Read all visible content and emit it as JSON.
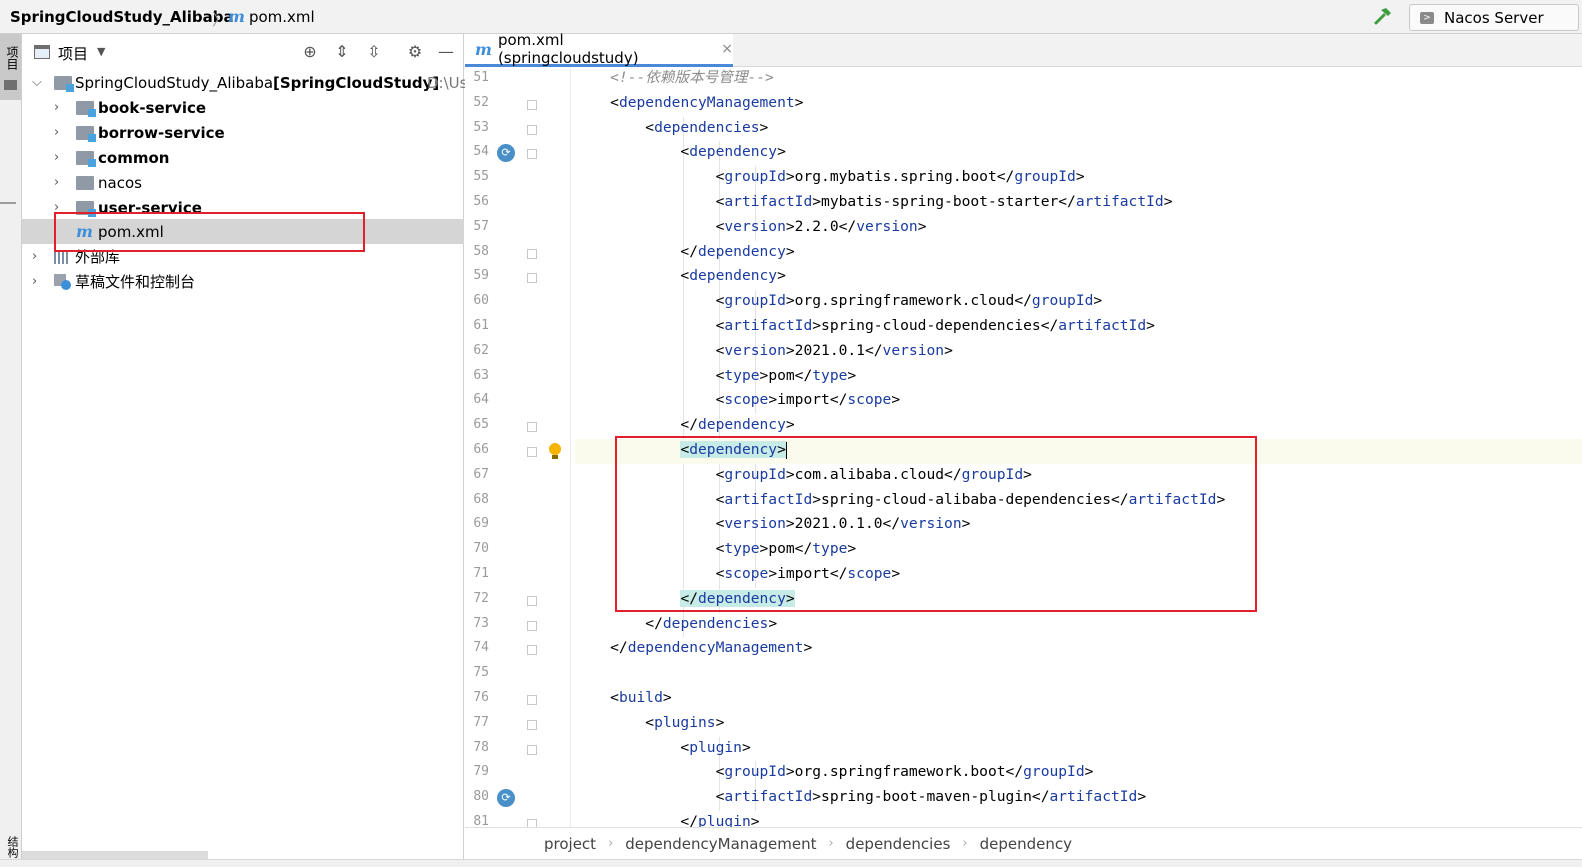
{
  "navbar": {
    "project_name": "SpringCloudStudy_Alibaba",
    "file_name": "pom.xml",
    "file_icon": "m",
    "run_config": "Nacos Server"
  },
  "stripe": {
    "project_tab": "项目",
    "structure_tab": "结构"
  },
  "project_panel": {
    "title": "项目",
    "tree": [
      {
        "label": "SpringCloudStudy_Alibaba",
        "module": "[SpringCloudStudy]",
        "path": "D:\\Us"
      },
      {
        "label": "book-service"
      },
      {
        "label": "borrow-service"
      },
      {
        "label": "common"
      },
      {
        "label": "nacos"
      },
      {
        "label": "user-service"
      },
      {
        "label": "pom.xml",
        "icon": "m"
      },
      {
        "label": "外部库"
      },
      {
        "label": "草稿文件和控制台"
      }
    ]
  },
  "editor": {
    "tab_label": "pom.xml (springcloudstudy)",
    "tab_close": "×",
    "lines": [
      {
        "n": "51",
        "text": "    <!--依赖版本号管理-->"
      },
      {
        "n": "52",
        "text": "    <dependencyManagement>"
      },
      {
        "n": "53",
        "text": "        <dependencies>"
      },
      {
        "n": "54",
        "text": "            <dependency>"
      },
      {
        "n": "55",
        "text": "                <groupId>org.mybatis.spring.boot</groupId>"
      },
      {
        "n": "56",
        "text": "                <artifactId>mybatis-spring-boot-starter</artifactId>"
      },
      {
        "n": "57",
        "text": "                <version>2.2.0</version>"
      },
      {
        "n": "58",
        "text": "            </dependency>"
      },
      {
        "n": "59",
        "text": "            <dependency>"
      },
      {
        "n": "60",
        "text": "                <groupId>org.springframework.cloud</groupId>"
      },
      {
        "n": "61",
        "text": "                <artifactId>spring-cloud-dependencies</artifactId>"
      },
      {
        "n": "62",
        "text": "                <version>2021.0.1</version>"
      },
      {
        "n": "63",
        "text": "                <type>pom</type>"
      },
      {
        "n": "64",
        "text": "                <scope>import</scope>"
      },
      {
        "n": "65",
        "text": "            </dependency>"
      },
      {
        "n": "66",
        "text": "            <dependency>"
      },
      {
        "n": "67",
        "text": "                <groupId>com.alibaba.cloud</groupId>"
      },
      {
        "n": "68",
        "text": "                <artifactId>spring-cloud-alibaba-dependencies</artifactId>"
      },
      {
        "n": "69",
        "text": "                <version>2021.0.1.0</version>"
      },
      {
        "n": "70",
        "text": "                <type>pom</type>"
      },
      {
        "n": "71",
        "text": "                <scope>import</scope>"
      },
      {
        "n": "72",
        "text": "            </dependency>"
      },
      {
        "n": "73",
        "text": "        </dependencies>"
      },
      {
        "n": "74",
        "text": "    </dependencyManagement>"
      },
      {
        "n": "75",
        "text": ""
      },
      {
        "n": "76",
        "text": "    <build>"
      },
      {
        "n": "77",
        "text": "        <plugins>"
      },
      {
        "n": "78",
        "text": "            <plugin>"
      },
      {
        "n": "79",
        "text": "                <groupId>org.springframework.boot</groupId>"
      },
      {
        "n": "80",
        "text": "                <artifactId>spring-boot-maven-plugin</artifactId>"
      },
      {
        "n": "81",
        "text": "            </plugin>"
      }
    ]
  },
  "breadcrumbs": [
    "project",
    "dependencyManagement",
    "dependencies",
    "dependency"
  ],
  "colors": {
    "tag": "#1a3ba0",
    "comment": "#8c8c8c",
    "highlight_box": "#e0202a",
    "selection": "#d5d5d5"
  }
}
